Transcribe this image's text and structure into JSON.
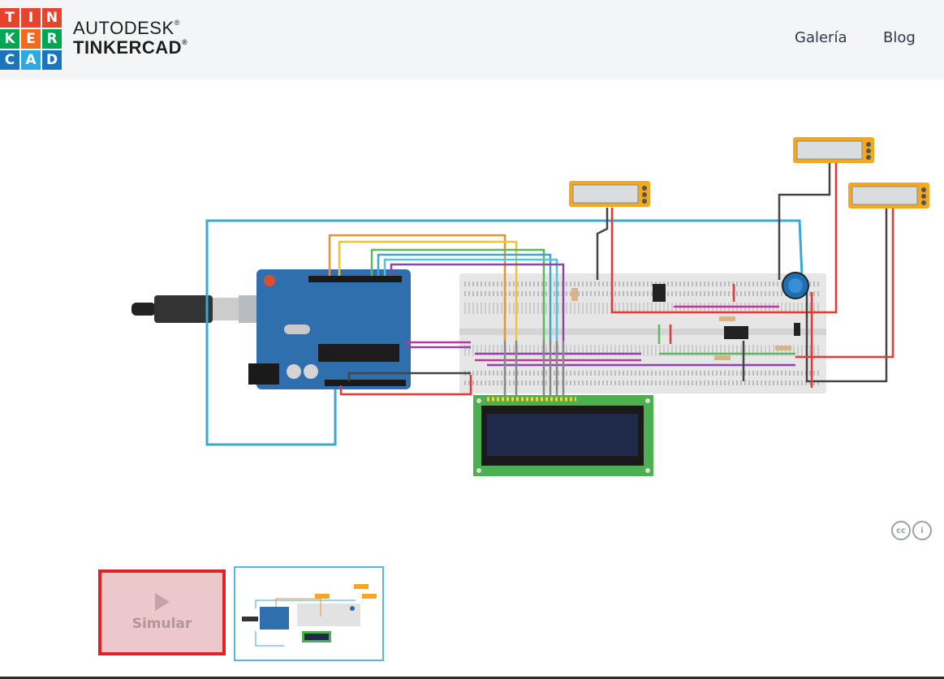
{
  "header": {
    "logo_letters": [
      "T",
      "I",
      "N",
      "K",
      "E",
      "R",
      "C",
      "A",
      "D"
    ],
    "logo_colors": [
      "#e8432b",
      "#e8432b",
      "#e8432b",
      "#00a651",
      "#f26a1b",
      "#00a651",
      "#1a75bc",
      "#29aae1",
      "#1a75bc"
    ],
    "brand_line1": "AUTODESK",
    "brand_line2": "TINKERCAD",
    "brand_mark": "®",
    "nav": [
      {
        "label": "Galería"
      },
      {
        "label": "Blog"
      }
    ]
  },
  "viewer": {
    "license_icons": [
      "cc-icon",
      "attribution-icon"
    ],
    "license_glyphs": [
      "cc",
      "i"
    ]
  },
  "controls": {
    "simulate_label": "Simular",
    "simulate_icon": "play-icon"
  },
  "colors": {
    "accent_red": "#e02129",
    "thumb_border": "#59b6e0",
    "arduino_blue": "#2f6fae",
    "lcd_green": "#4caf50"
  }
}
